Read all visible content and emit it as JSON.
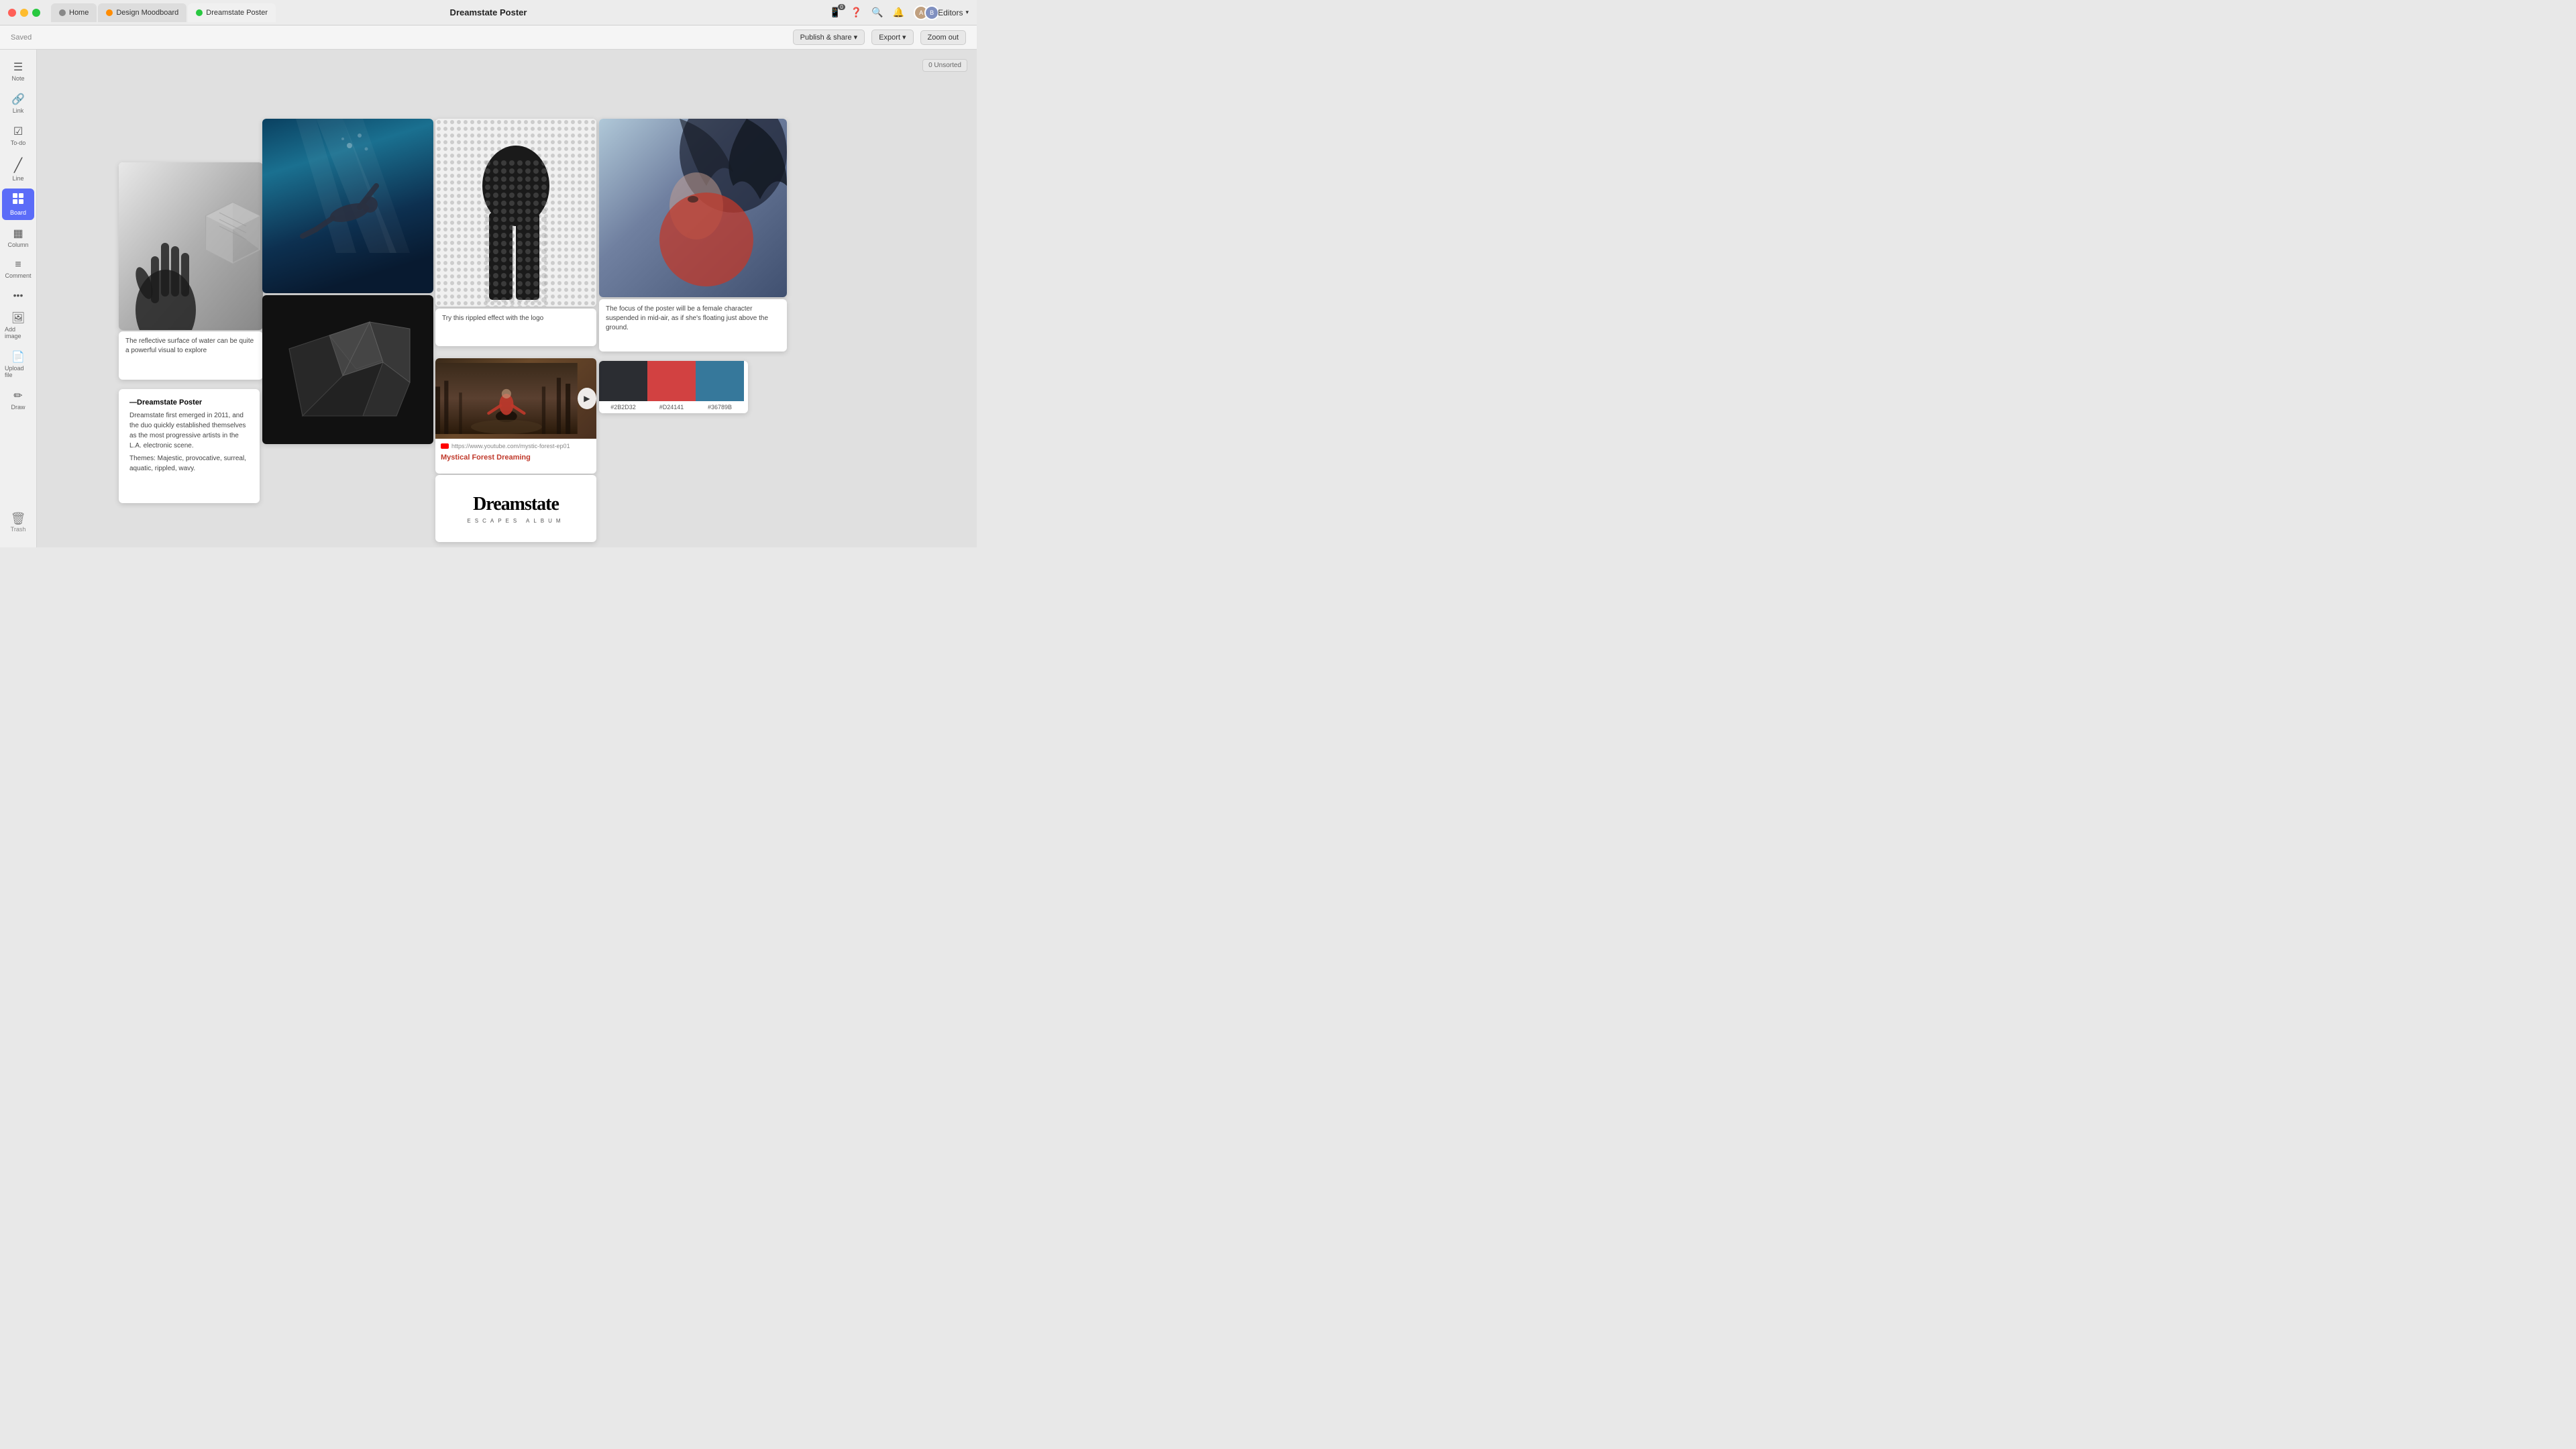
{
  "titlebar": {
    "title": "Dreamstate Poster",
    "tabs": [
      {
        "label": "Home",
        "color": "#888",
        "active": false
      },
      {
        "label": "Design Moodboard",
        "color": "#ff8c00",
        "active": false
      },
      {
        "label": "Dreamstate Poster",
        "color": "#28c840",
        "active": true
      }
    ],
    "saved": "Saved",
    "editors_label": "Editors",
    "publish_label": "Publish & share",
    "export_label": "Export",
    "zoom_label": "Zoom out"
  },
  "sidebar": {
    "items": [
      {
        "id": "note",
        "icon": "☰",
        "label": "Note"
      },
      {
        "id": "link",
        "icon": "🔗",
        "label": "Link"
      },
      {
        "id": "todo",
        "icon": "☑",
        "label": "To-do"
      },
      {
        "id": "line",
        "icon": "╱",
        "label": "Line"
      },
      {
        "id": "board",
        "icon": "⊞",
        "label": "Board",
        "active": true
      },
      {
        "id": "column",
        "icon": "▦",
        "label": "Column"
      },
      {
        "id": "comment",
        "icon": "≡",
        "label": "Comment"
      },
      {
        "id": "more",
        "icon": "•••",
        "label": ""
      },
      {
        "id": "image",
        "icon": "🖼",
        "label": "Add image"
      },
      {
        "id": "file",
        "icon": "📄",
        "label": "Upload file"
      },
      {
        "id": "draw",
        "icon": "✏",
        "label": "Draw"
      }
    ],
    "trash_label": "Trash"
  },
  "canvas": {
    "unsorted_label": "0 Unsorted",
    "cards": {
      "text_card": {
        "heading": "—Dreamstate Poster",
        "body1": "Dreamstate first emerged in 2011, and the duo quickly established themselves as the most progressive artists in the L.A. electronic scene.",
        "body2": "Themes: Majestic, provocative, surreal, aquatic, rippled, wavy."
      },
      "water_caption": "The reflective surface of water can be quite a powerful visual to explore",
      "halftone_caption": "Try this rippled effect with the logo",
      "portrait_caption": "The focus of the poster will be a female character suspended in mid-air, as if  she's floating just above the ground.",
      "video_url": "https://www.youtube.com/mystic-forest-ep01",
      "video_title": "Mystical Forest Dreaming",
      "logo_title": "Dreamstate",
      "logo_subtitle": "ESCAPES ALBUM",
      "colors": [
        {
          "hex": "#2B2D32",
          "label": "#2B2D32"
        },
        {
          "hex": "#D24141",
          "label": "#D24141"
        },
        {
          "hex": "#36789B",
          "label": "#36789B"
        }
      ]
    }
  }
}
